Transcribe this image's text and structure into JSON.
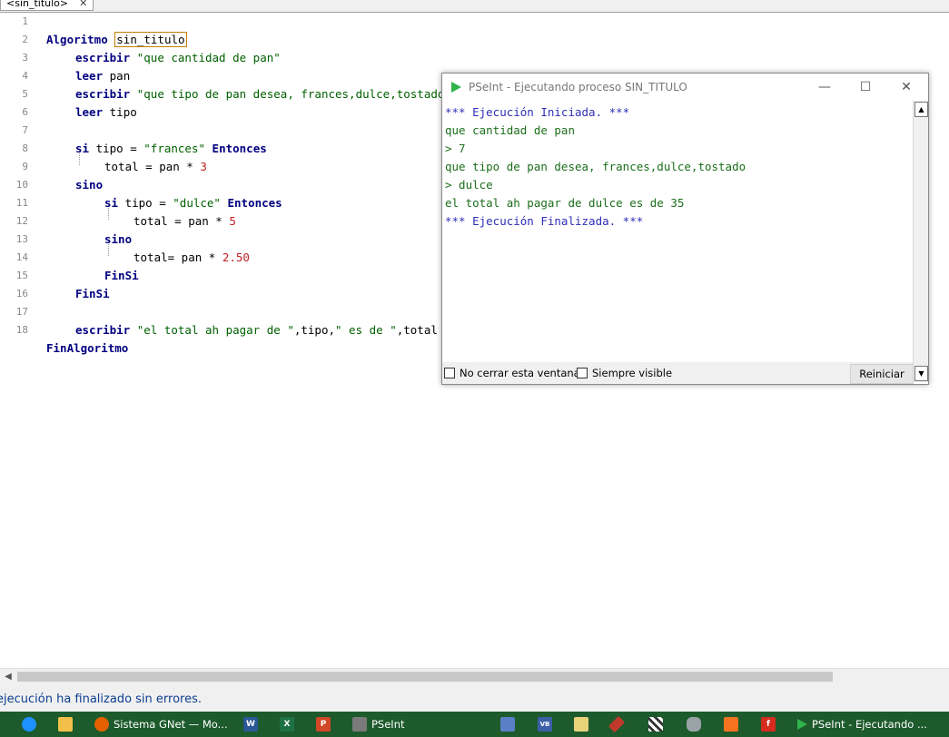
{
  "tab": {
    "label": "<sin_titulo>",
    "close": "✕"
  },
  "editor": {
    "lines": [
      {
        "n": "1"
      },
      {
        "n": "2"
      },
      {
        "n": "3"
      },
      {
        "n": "4"
      },
      {
        "n": "5"
      },
      {
        "n": "6"
      },
      {
        "n": "7"
      },
      {
        "n": "8"
      },
      {
        "n": "9"
      },
      {
        "n": "10"
      },
      {
        "n": "11"
      },
      {
        "n": "12"
      },
      {
        "n": "13"
      },
      {
        "n": "14"
      },
      {
        "n": "15"
      },
      {
        "n": "16"
      },
      {
        "n": "17"
      },
      {
        "n": "18"
      }
    ],
    "tokens": {
      "algoritmo": "Algoritmo",
      "name": "sin_titulo",
      "escribir": "escribir",
      "leer": "leer",
      "si": "si",
      "sino": "sino",
      "entonces": "Entonces",
      "finsi": "FinSi",
      "finalgoritmo": "FinAlgoritmo",
      "s_cantidad": "\"que cantidad de pan\"",
      "v_pan": "pan",
      "s_tipo": "\"que tipo de pan desea, frances,dulce,tostado\"",
      "v_tipo": "tipo",
      "cond1": "tipo = ",
      "s_frances": "\"frances\"",
      "assign1": "total = pan * ",
      "n3": "3",
      "s_dulce": "\"dulce\"",
      "assign2": "total = pan * ",
      "n5": "5",
      "assign3": "total= pan * ",
      "n250": "2.50",
      "s_total": "\"el total ah pagar de \"",
      "sep1": ",tipo,",
      "s_esde": "\" es de \"",
      "sep2": ",total"
    }
  },
  "status": {
    "text": "ejecución ha finalizado sin errores."
  },
  "run_window": {
    "title": "PSeInt - Ejecutando proceso SIN_TITULO",
    "minimize": "—",
    "maximize": "☐",
    "close": "✕",
    "output": [
      {
        "text": "*** Ejecución Iniciada. ***",
        "kind": "sys"
      },
      {
        "text": "que cantidad de pan",
        "kind": "out"
      },
      {
        "text": "> 7",
        "kind": "in"
      },
      {
        "text": "que tipo de pan desea, frances,dulce,tostado",
        "kind": "out"
      },
      {
        "text": "> dulce",
        "kind": "in"
      },
      {
        "text": "el total ah pagar de dulce es de 35",
        "kind": "out"
      },
      {
        "text": "*** Ejecución Finalizada. ***",
        "kind": "sys"
      }
    ],
    "no_close_label": "No cerrar esta ventana",
    "always_visible_label": "Siempre visible",
    "restart_label": "Reiniciar"
  },
  "taskbar": {
    "items": [
      {
        "label": "",
        "icon": "app-icon"
      },
      {
        "label": "",
        "icon": "folder-icon"
      },
      {
        "label": "Sistema GNet — Mo...",
        "icon": "firefox-icon"
      },
      {
        "label": "",
        "icon": "word-icon"
      },
      {
        "label": "",
        "icon": "excel-icon"
      },
      {
        "label": "",
        "icon": "powerpoint-icon"
      },
      {
        "label": "PSeInt",
        "icon": "pseint-icon"
      },
      {
        "label": "",
        "icon": "chart-app-icon"
      },
      {
        "label": "",
        "icon": "vb-icon"
      },
      {
        "label": "",
        "icon": "notepad-icon"
      },
      {
        "label": "",
        "icon": "tool-icon"
      },
      {
        "label": "",
        "icon": "grid-icon"
      },
      {
        "label": "",
        "icon": "database-icon"
      },
      {
        "label": "",
        "icon": "xampp-icon"
      },
      {
        "label": "",
        "icon": "f-icon"
      },
      {
        "label": "PSeInt - Ejecutando ...",
        "icon": "pseint-run-icon"
      }
    ],
    "letters": {
      "word": "W",
      "excel": "X",
      "ppt": "P",
      "vb": "VB",
      "f": "f"
    }
  },
  "colors": {
    "keyword": "#000080",
    "string": "#006000",
    "number": "#c02020",
    "taskbar": "#1d5a2c",
    "run_output": "#1a6e1a",
    "run_system": "#2e2eb8"
  }
}
